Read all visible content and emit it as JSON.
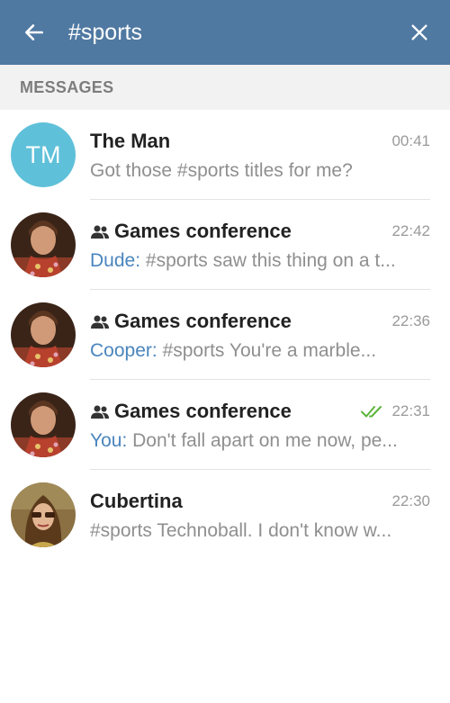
{
  "header": {
    "query": "#sports",
    "back_icon": "arrow-left-icon",
    "close_icon": "close-icon",
    "background": "#5079a2"
  },
  "section": {
    "title": "MESSAGES"
  },
  "results": [
    {
      "name": "The Man",
      "initials": "TM",
      "time": "00:41",
      "sender": "",
      "text": "Got those #sports titles for me?",
      "is_group": false
    },
    {
      "name": "Games conference",
      "time": "22:42",
      "sender": "Dude:",
      "text": "#sports saw this thing on a t...",
      "is_group": true
    },
    {
      "name": "Games conference",
      "time": "22:36",
      "sender": "Cooper:",
      "text": "#sports You're a marble...",
      "is_group": true
    },
    {
      "name": "Games conference",
      "time": "22:31",
      "sender": "You:",
      "text": "Don't fall apart on me now, pe...",
      "is_group": true,
      "read": true
    },
    {
      "name": "Cubertina",
      "time": "22:30",
      "sender": "",
      "text": "#sports Technoball. I don't know w...",
      "is_group": false
    }
  ],
  "colors": {
    "sender": "#4a85bd",
    "read_ticks": "#5cb43a",
    "initials_avatar": "#5fc0d9"
  }
}
